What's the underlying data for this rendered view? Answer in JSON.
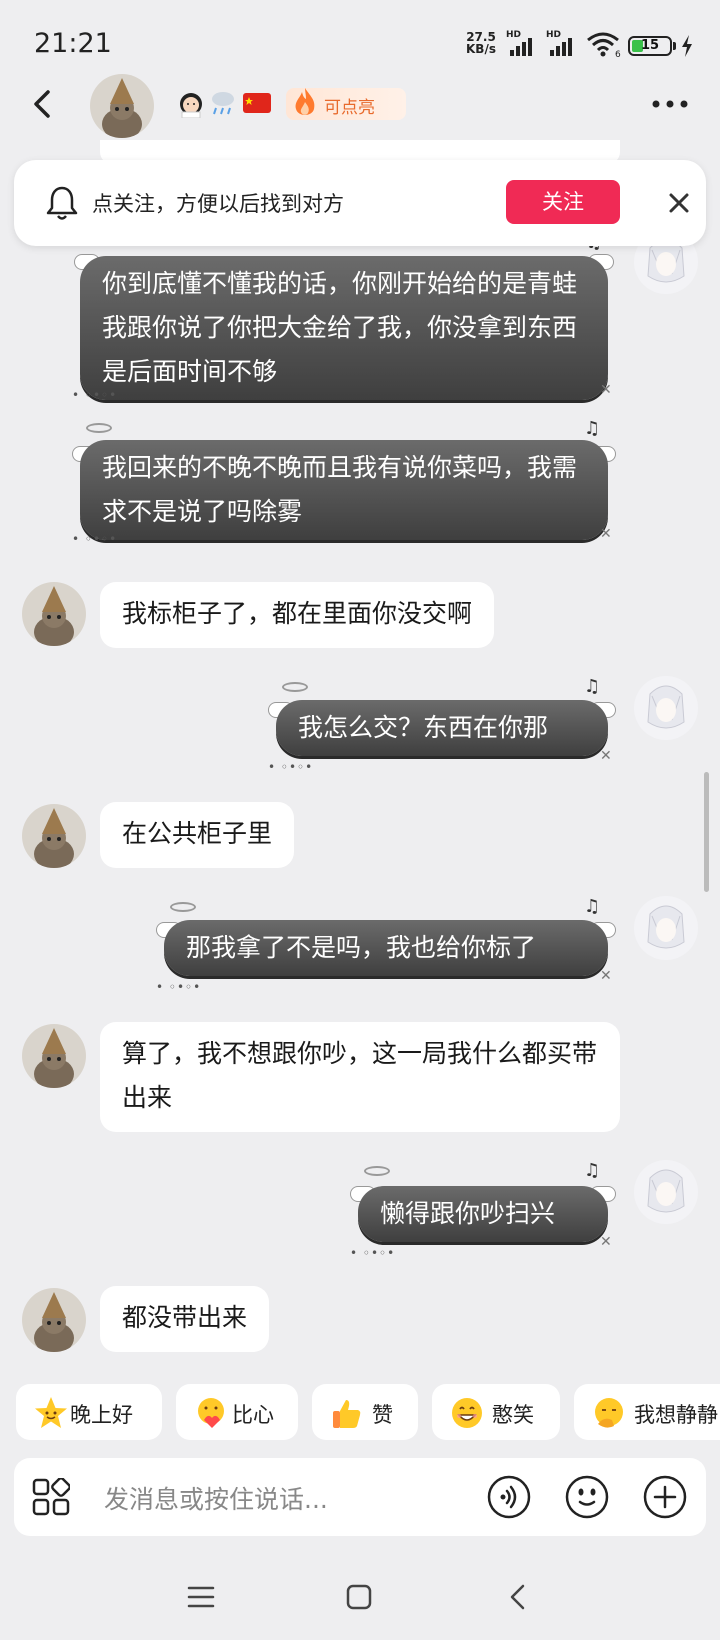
{
  "status_bar": {
    "time": "21:21",
    "net_speed_value": "27.5",
    "net_speed_unit": "KB/s",
    "signal_1_label": "HD",
    "signal_2_label": "HD",
    "wifi_badge": "6",
    "battery": "15"
  },
  "header": {
    "emojis": [
      "woman-icon",
      "rain-cloud-icon",
      "china-flag-icon"
    ],
    "fire_label": "可点亮"
  },
  "follow_banner": {
    "text": "点关注，方便以后找到对方",
    "button": "关注"
  },
  "messages": [
    {
      "side": "right",
      "text": "你到底懂不懂我的话，你刚开始给的是青蛙我跟你说了你把大金给了我，你没拿到东西是后面时间不够"
    },
    {
      "side": "right",
      "text": "我回来的不晚不晚而且我有说你菜吗，我需求不是说了吗除雾"
    },
    {
      "side": "left",
      "text": "我标柜子了，都在里面你没交啊"
    },
    {
      "side": "right",
      "text": "我怎么交？东西在你那"
    },
    {
      "side": "left",
      "text": "在公共柜子里"
    },
    {
      "side": "right",
      "text": "那我拿了不是吗，我也给你标了"
    },
    {
      "side": "left",
      "text": "算了，我不想跟你吵，这一局我什么都买带出来"
    },
    {
      "side": "right",
      "text": "懒得跟你吵扫兴"
    },
    {
      "side": "left",
      "text": "都没带出来"
    }
  ],
  "quick_replies": [
    {
      "label": "晚上好",
      "icon": "star-face-icon"
    },
    {
      "label": "比心",
      "icon": "heart-hands-icon"
    },
    {
      "label": "赞",
      "icon": "thumbs-up-icon"
    },
    {
      "label": "憨笑",
      "icon": "grin-face-icon"
    },
    {
      "label": "我想静静",
      "icon": "thinking-face-icon"
    }
  ],
  "input": {
    "placeholder": "发消息或按住说话..."
  },
  "colors": {
    "accent": "#f02a55",
    "background": "#eeeef0",
    "dark_bubble": "#4a4a4a",
    "fire": "#ff7a2e"
  }
}
